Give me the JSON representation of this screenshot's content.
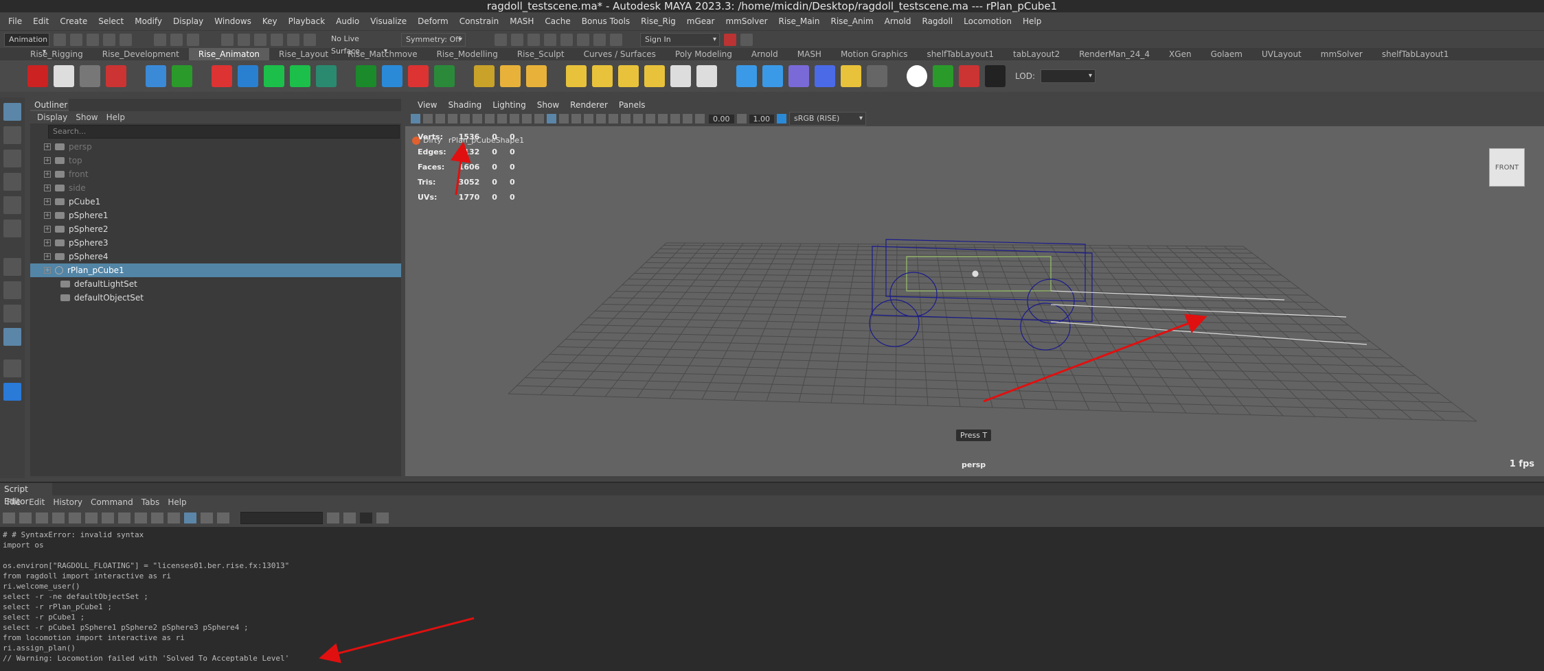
{
  "title": "ragdoll_testscene.ma* - Autodesk MAYA 2023.3: /home/micdin/Desktop/ragdoll_testscene.ma  ---  rPlan_pCube1",
  "menubar": [
    "File",
    "Edit",
    "Create",
    "Select",
    "Modify",
    "Display",
    "Windows",
    "Key",
    "Playback",
    "Audio",
    "Visualize",
    "Deform",
    "Constrain",
    "MASH",
    "Cache",
    "Bonus Tools",
    "Rise_Rig",
    "mGear",
    "mmSolver",
    "Rise_Main",
    "Rise_Anim",
    "Arnold",
    "Ragdoll",
    "Locomotion",
    "Help"
  ],
  "statusline": {
    "mode": "Animation",
    "live_surface": "No Live Surface",
    "symmetry": "Symmetry: Off",
    "sign_in": "Sign In"
  },
  "shelf_tabs": [
    "Rise_Rigging",
    "Rise_Development",
    "Rise_Animaton",
    "Rise_Layout",
    "Rise_Matchmove",
    "Rise_Modelling",
    "Rise_Sculpt",
    "Curves / Surfaces",
    "Poly Modeling",
    "Arnold",
    "MASH",
    "Motion Graphics",
    "shelfTabLayout1",
    "tabLayout2",
    "RenderMan_24_4",
    "XGen",
    "Golaem",
    "UVLayout",
    "mmSolver",
    "shelfTabLayout1"
  ],
  "shelf_active": "Rise_Animaton",
  "shelf_labels": {
    "lod": "LOD:"
  },
  "outliner": {
    "tab": "Outliner",
    "menu": [
      "Display",
      "Show",
      "Help"
    ],
    "search_placeholder": "Search...",
    "items": [
      {
        "label": "persp",
        "dim": true,
        "type": "camera"
      },
      {
        "label": "top",
        "dim": true,
        "type": "camera"
      },
      {
        "label": "front",
        "dim": true,
        "type": "camera"
      },
      {
        "label": "side",
        "dim": true,
        "type": "camera"
      },
      {
        "label": "pCube1",
        "dim": false,
        "type": "mesh"
      },
      {
        "label": "pSphere1",
        "dim": false,
        "type": "mesh"
      },
      {
        "label": "pSphere2",
        "dim": false,
        "type": "mesh"
      },
      {
        "label": "pSphere3",
        "dim": false,
        "type": "mesh"
      },
      {
        "label": "pSphere4",
        "dim": false,
        "type": "mesh"
      },
      {
        "label": "rPlan_pCube1",
        "dim": false,
        "type": "plan",
        "selected": true
      },
      {
        "label": "defaultLightSet",
        "dim": false,
        "type": "set"
      },
      {
        "label": "defaultObjectSet",
        "dim": false,
        "type": "set"
      }
    ]
  },
  "viewport": {
    "menu": [
      "View",
      "Shading",
      "Lighting",
      "Show",
      "Renderer",
      "Panels"
    ],
    "field1": "0.00",
    "field2": "1.00",
    "colorspace": "sRGB (RISE)",
    "hud": [
      {
        "label": "Verts:",
        "a": "1536",
        "b": "0",
        "c": "0"
      },
      {
        "label": "Edges:",
        "a": "3132",
        "b": "0",
        "c": "0"
      },
      {
        "label": "Faces:",
        "a": "1606",
        "b": "0",
        "c": "0"
      },
      {
        "label": "Tris:",
        "a": "3052",
        "b": "0",
        "c": "0"
      },
      {
        "label": "UVs:",
        "a": "1770",
        "b": "0",
        "c": "0"
      }
    ],
    "dirty": "Dirty",
    "dirty_node": "rPlan_pCubeShape1",
    "camera": "persp",
    "fps": "1 fps",
    "press_t": "Press T",
    "cube_face": "FRONT"
  },
  "script_editor": {
    "tab": "Script Editor",
    "menu": [
      "File",
      "Edit",
      "History",
      "Command",
      "Tabs",
      "Help"
    ],
    "lines": [
      "# # SyntaxError: invalid syntax",
      "import os",
      "",
      "os.environ[\"RAGDOLL_FLOATING\"] = \"licenses01.ber.rise.fx:13013\"",
      "from ragdoll import interactive as ri",
      "ri.welcome_user()",
      "select -r -ne defaultObjectSet ;",
      "select -r rPlan_pCube1 ;",
      "select -r pCube1 ;",
      "select -r pCube1 pSphere1 pSphere2 pSphere3 pSphere4 ;",
      "from locomotion import interactive as ri",
      "ri.assign_plan()",
      "// Warning: Locomotion failed with 'Solved To Acceptable Level'"
    ]
  },
  "colors": {
    "accent": "#5285a6",
    "arrow": "#e01010",
    "wire": "#1a1a8c"
  }
}
